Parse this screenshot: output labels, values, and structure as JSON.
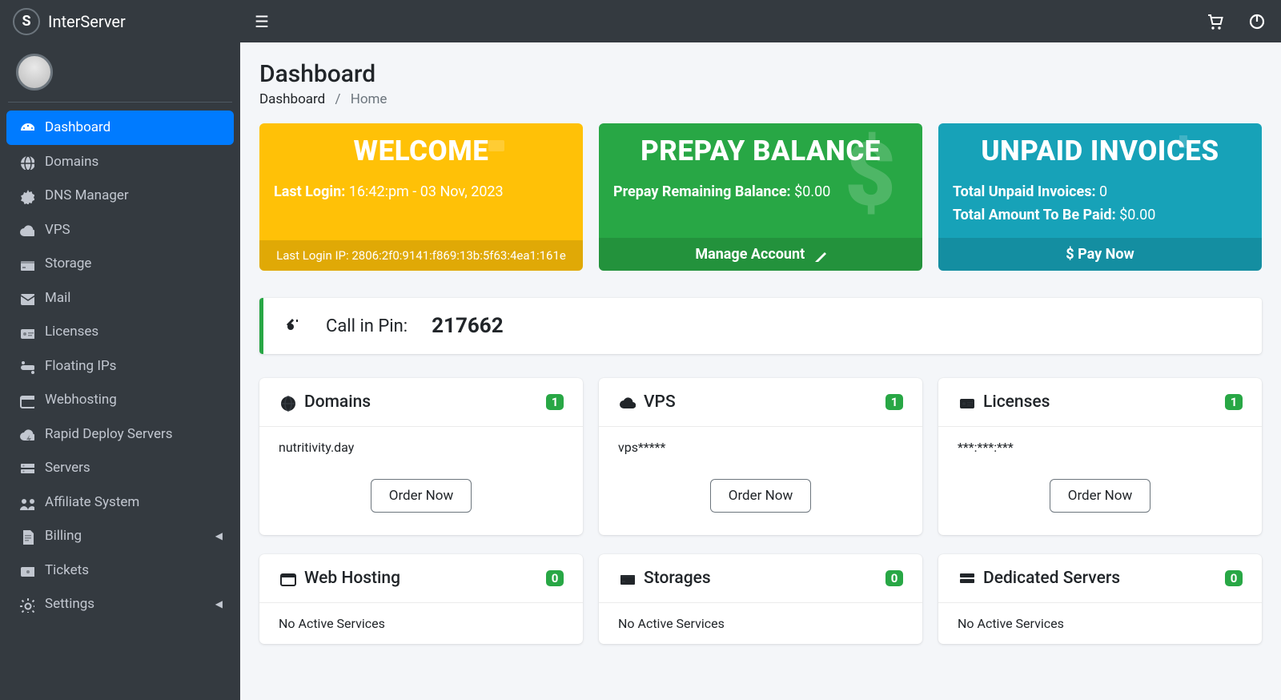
{
  "brand": {
    "name": "InterServer",
    "logo_letter": "S"
  },
  "sidebar": {
    "items": [
      {
        "label": "Dashboard",
        "icon": "gauge-icon",
        "active": true,
        "expandable": false
      },
      {
        "label": "Domains",
        "icon": "globe-icon",
        "active": false,
        "expandable": false
      },
      {
        "label": "DNS Manager",
        "icon": "gear-icon",
        "active": false,
        "expandable": false
      },
      {
        "label": "VPS",
        "icon": "cloud-icon",
        "active": false,
        "expandable": false
      },
      {
        "label": "Storage",
        "icon": "storage-icon",
        "active": false,
        "expandable": false
      },
      {
        "label": "Mail",
        "icon": "mail-icon",
        "active": false,
        "expandable": false
      },
      {
        "label": "Licenses",
        "icon": "license-icon",
        "active": false,
        "expandable": false
      },
      {
        "label": "Floating IPs",
        "icon": "float-icon",
        "active": false,
        "expandable": false
      },
      {
        "label": "Webhosting",
        "icon": "webhost-icon",
        "active": false,
        "expandable": false
      },
      {
        "label": "Rapid Deploy Servers",
        "icon": "rapid-icon",
        "active": false,
        "expandable": false
      },
      {
        "label": "Servers",
        "icon": "servers-icon",
        "active": false,
        "expandable": false
      },
      {
        "label": "Affiliate System",
        "icon": "affiliate-icon",
        "active": false,
        "expandable": false
      },
      {
        "label": "Billing",
        "icon": "billing-icon",
        "active": false,
        "expandable": true
      },
      {
        "label": "Tickets",
        "icon": "tickets-icon",
        "active": false,
        "expandable": false
      },
      {
        "label": "Settings",
        "icon": "settings-icon",
        "active": false,
        "expandable": true
      }
    ]
  },
  "header": {
    "title": "Dashboard",
    "breadcrumb": [
      "Dashboard",
      "Home"
    ]
  },
  "info_boxes": {
    "welcome": {
      "title": "WELCOME",
      "last_login_label": "Last Login:",
      "last_login_value": "16:42:pm - 03 Nov, 2023",
      "last_ip_label": "Last Login IP:",
      "last_ip_value": "2806:2f0:9141:f869:13b:5f63:4ea1:161e"
    },
    "prepay": {
      "title": "PREPAY BALANCE",
      "balance_label": "Prepay Remaining Balance:",
      "balance_value": "$0.00",
      "cta": "Manage Account"
    },
    "unpaid": {
      "title": "UNPAID INVOICES",
      "count_label": "Total Unpaid Invoices:",
      "count_value": "0",
      "amount_label": "Total Amount To Be Paid:",
      "amount_value": "$0.00",
      "cta": "$ Pay Now"
    }
  },
  "callout": {
    "label": "Call in Pin:",
    "pin": "217662"
  },
  "service_cards": [
    {
      "title": "Domains",
      "icon": "globe-icon",
      "badge": "1",
      "body": "nutritivity.day",
      "cta": "Order Now"
    },
    {
      "title": "VPS",
      "icon": "cloud-icon",
      "badge": "1",
      "body": "vps*****",
      "cta": "Order Now"
    },
    {
      "title": "Licenses",
      "icon": "license-icon",
      "badge": "1",
      "body": "***:***:***",
      "cta": "Order Now"
    },
    {
      "title": "Web Hosting",
      "icon": "webhost-icon",
      "badge": "0",
      "body": "No Active Services",
      "cta": ""
    },
    {
      "title": "Storages",
      "icon": "storage-icon",
      "badge": "0",
      "body": "No Active Services",
      "cta": ""
    },
    {
      "title": "Dedicated Servers",
      "icon": "servers-icon",
      "badge": "0",
      "body": "No Active Services",
      "cta": ""
    }
  ]
}
